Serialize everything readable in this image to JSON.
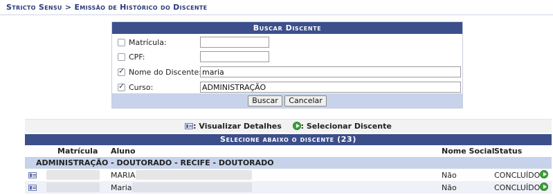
{
  "breadcrumb": "Stricto Sensu > Emissão de Histórico do Discente",
  "search": {
    "caption": "Buscar Discente",
    "fields": [
      {
        "label": "Matrícula:",
        "checked": false,
        "value": ""
      },
      {
        "label": "CPF:",
        "checked": false,
        "value": ""
      },
      {
        "label": "Nome do Discente:",
        "checked": true,
        "value": "maria"
      },
      {
        "label": "Curso:",
        "checked": true,
        "value": "ADMINISTRAÇÃO"
      }
    ],
    "buscar_label": "Buscar",
    "cancelar_label": "Cancelar"
  },
  "legend": {
    "visualizar": ": Visualizar Detalhes",
    "selecionar": ": Selecionar Discente"
  },
  "results": {
    "caption": "Selecione abaixo o discente (23)",
    "columns": {
      "matricula": "Matrícula",
      "aluno": "Aluno",
      "nome_social": "Nome Social",
      "status": "Status"
    },
    "group": "ADMINISTRAÇÃO - DOUTORADO - RECIFE - DOUTORADO",
    "rows": [
      {
        "aluno": "MARIA",
        "nome_social": "Não",
        "status": "CONCLUÍDO"
      },
      {
        "aluno": "Maria",
        "nome_social": "Não",
        "status": "CONCLUÍDO"
      }
    ]
  }
}
